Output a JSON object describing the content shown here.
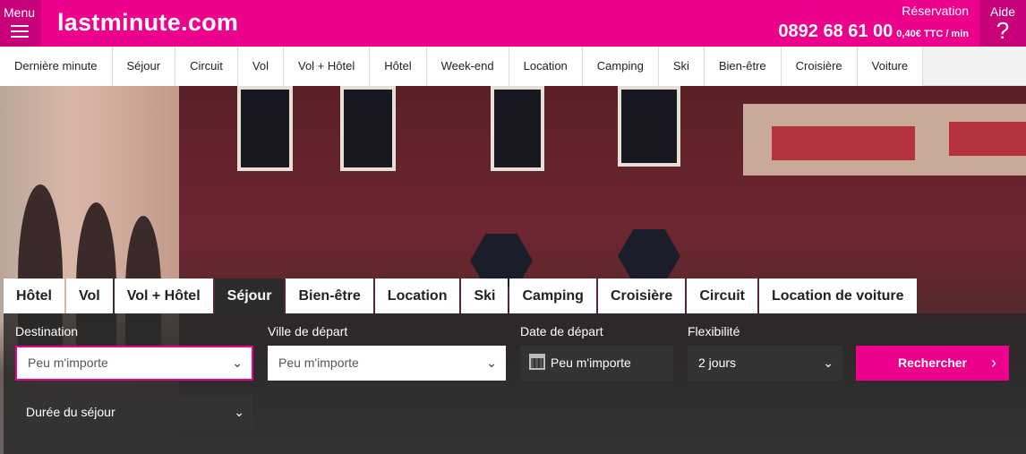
{
  "header": {
    "menu_label": "Menu",
    "logo": "lastminute.com",
    "reservation_label": "Réservation",
    "phone": "0892 68 61 00",
    "price": "0,40€ TTC / min",
    "help_label": "Aide",
    "help_glyph": "?",
    "brand_color": "#ec008c"
  },
  "nav": {
    "items": [
      "Dernière minute",
      "Séjour",
      "Circuit",
      "Vol",
      "Vol + Hôtel",
      "Hôtel",
      "Week-end",
      "Location",
      "Camping",
      "Ski",
      "Bien-être",
      "Croisière",
      "Voiture"
    ]
  },
  "search": {
    "tabs": [
      "Hôtel",
      "Vol",
      "Vol + Hôtel",
      "Séjour",
      "Bien-être",
      "Location",
      "Ski",
      "Camping",
      "Croisière",
      "Circuit",
      "Location de voiture"
    ],
    "active_tab": "Séjour",
    "destination_label": "Destination",
    "destination_value": "Peu m'importe",
    "departure_city_label": "Ville de départ",
    "departure_city_value": "Peu m'importe",
    "departure_date_label": "Date de départ",
    "departure_date_value": "Peu m'importe",
    "flexibility_label": "Flexibilité",
    "flexibility_value": "2 jours",
    "search_button": "Rechercher",
    "duration_value": "Durée du séjour"
  }
}
